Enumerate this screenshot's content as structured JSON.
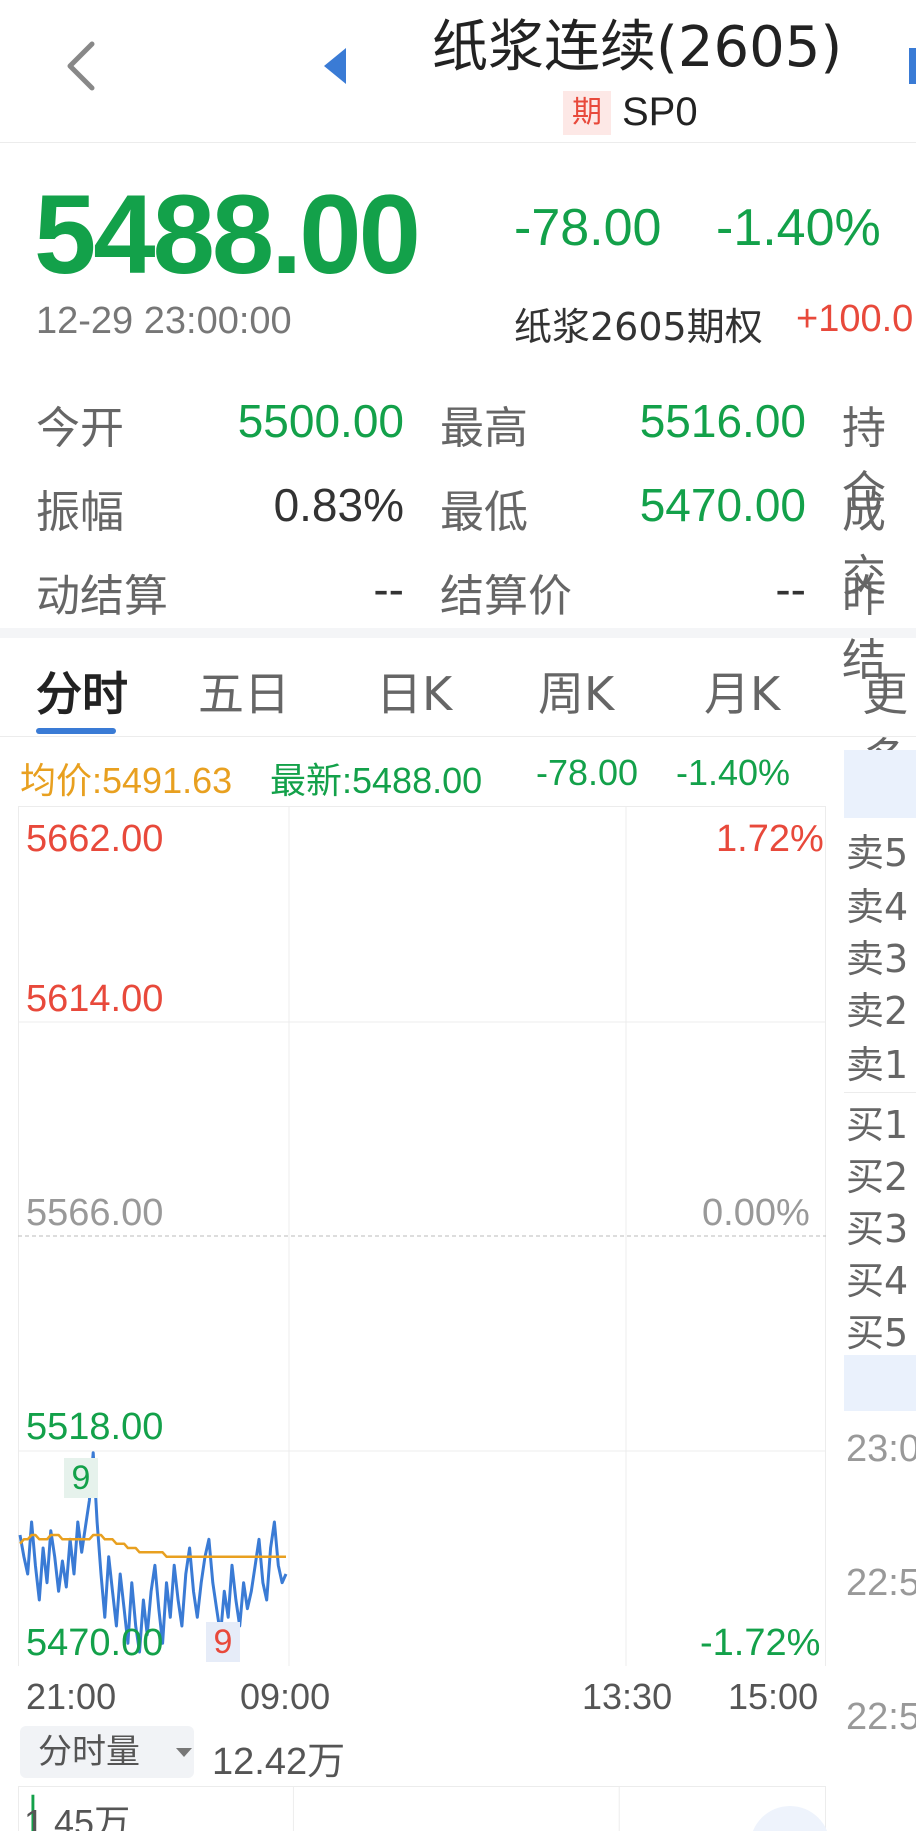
{
  "header": {
    "title": "纸浆连续(2605)",
    "badge": "期",
    "code": "SP0"
  },
  "quote": {
    "price": "5488.00",
    "change": "-78.00",
    "change_pct": "-1.40%",
    "time": "12-29 23:00:00",
    "option_name": "纸浆2605期权",
    "option_value": "+100.0"
  },
  "stats": [
    {
      "label": "今开",
      "value": "5500.00",
      "color": "green"
    },
    {
      "label": "最高",
      "value": "5516.00",
      "color": "green"
    },
    {
      "label": "持仓",
      "value": ""
    },
    {
      "label": "振幅",
      "value": "0.83%",
      "color": "dark"
    },
    {
      "label": "最低",
      "value": "5470.00",
      "color": "green"
    },
    {
      "label": "成交",
      "value": ""
    },
    {
      "label": "动结算",
      "value": "--",
      "color": "dark"
    },
    {
      "label": "结算价",
      "value": "--",
      "color": "dark"
    },
    {
      "label": "昨结",
      "value": ""
    }
  ],
  "tabs": [
    "分时",
    "五日",
    "日K",
    "周K",
    "月K",
    "更多"
  ],
  "info": {
    "avg": "均价:5491.63",
    "latest": "最新:5488.00",
    "change": "-78.00",
    "pct": "-1.40%"
  },
  "chart_data": {
    "type": "line",
    "y_labels": [
      "5662.00",
      "5614.00",
      "5566.00",
      "5518.00",
      "5470.00"
    ],
    "pct_labels": [
      "1.72%",
      "0.00%",
      "-1.72%"
    ],
    "x_labels": [
      "21:00",
      "09:00",
      "13:30",
      "15:00"
    ],
    "ylim": [
      5470,
      5662
    ],
    "reference": 5566,
    "markers": [
      {
        "text": "9",
        "at": "high",
        "color": "#13a14a"
      },
      {
        "text": "9",
        "at": "low",
        "color": "#e8493b"
      }
    ],
    "series": [
      {
        "values": [
          5497,
          5492,
          5488,
          5500,
          5490,
          5482,
          5494,
          5486,
          5498,
          5492,
          5484,
          5491,
          5485,
          5496,
          5488,
          5500,
          5493,
          5499,
          5505,
          5516,
          5500,
          5488,
          5478,
          5492,
          5484,
          5476,
          5488,
          5480,
          5472,
          5486,
          5476,
          5470,
          5482,
          5474,
          5484,
          5490,
          5480,
          5472,
          5486,
          5478,
          5490,
          5482,
          5476,
          5488,
          5494,
          5484,
          5478,
          5486,
          5492,
          5496,
          5486,
          5480,
          5474,
          5484,
          5478,
          5490,
          5482,
          5476,
          5486,
          5480,
          5484,
          5490,
          5496,
          5486,
          5482,
          5494,
          5500,
          5490,
          5486,
          5488
        ]
      },
      {
        "values": [
          5495,
          5496,
          5496,
          5497,
          5497,
          5496,
          5496,
          5496,
          5497,
          5497,
          5497,
          5496,
          5496,
          5496,
          5496,
          5496,
          5496,
          5496,
          5496,
          5497,
          5497,
          5497,
          5496,
          5496,
          5496,
          5495,
          5495,
          5495,
          5494,
          5494,
          5494,
          5493,
          5493,
          5493,
          5493,
          5493,
          5493,
          5493,
          5492,
          5492,
          5492,
          5492,
          5492,
          5492,
          5492,
          5492,
          5492,
          5492,
          5492,
          5492,
          5492,
          5492,
          5492,
          5492,
          5492,
          5492,
          5492,
          5492,
          5492,
          5492,
          5492,
          5492,
          5492,
          5492,
          5492,
          5492,
          5492,
          5492,
          5492,
          5492
        ]
      }
    ]
  },
  "orderbook": {
    "sell": [
      "卖5",
      "卖4",
      "卖3",
      "卖2",
      "卖1"
    ],
    "buy": [
      "买1",
      "买2",
      "买3",
      "买4",
      "买5"
    ],
    "times": [
      "23:0",
      "22:5",
      "22:5"
    ]
  },
  "volume": {
    "selector": "分时量",
    "total": "12.42万",
    "max": "1.45万"
  },
  "colors": {
    "down": "#13a14a",
    "up": "#e8493b",
    "avg": "#e8a020",
    "price_line": "#3a7bd5"
  }
}
